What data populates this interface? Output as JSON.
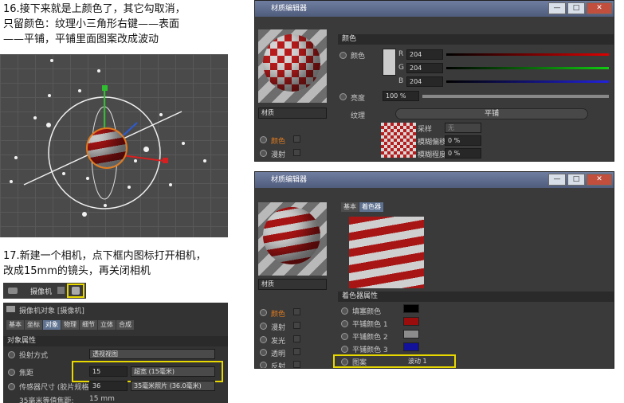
{
  "step16_text": [
    "16.接下来就是上颜色了，其它勾取消，",
    "只留颜色：纹理小三角形右键——表面",
    "——平铺，平铺里面图案改成波动"
  ],
  "step17_text": [
    "17.新建一个相机，点下框内图标打开相机，",
    "改成15mm的镜头，再关闭相机"
  ],
  "win1": {
    "title": "材质编辑器",
    "mat_name": "材质",
    "channels": [
      "颜色",
      "漫射"
    ],
    "section": "颜色",
    "color_label": "颜色",
    "r": "204",
    "g": "204",
    "b": "204",
    "brightness_label": "亮度",
    "brightness": "100 %",
    "texture_label": "纹理",
    "texture_button": "平铺",
    "sample_label": "采样",
    "sample_value": "无",
    "blur_offset_label": "模糊偏移",
    "blur_offset": "0 %",
    "blur_scale_label": "模糊程度",
    "blur_scale": "0 %"
  },
  "win2": {
    "title": "材质编辑器",
    "tabs": [
      "基本",
      "着色器"
    ],
    "mat_name": "材质",
    "channels": [
      "颜色",
      "漫射",
      "发光",
      "透明",
      "反射"
    ],
    "section": "着色器属性",
    "rows": [
      "填塞颜色",
      "平铺颜色 1",
      "平铺颜色 2",
      "平铺颜色 3"
    ],
    "pattern_label": "图案",
    "pattern_value": "波动 1",
    "swatch_colors": [
      "#000000",
      "#9b0d0d",
      "#8c8c8c",
      "#12129a"
    ]
  },
  "camera_bar": {
    "label": "摄像机"
  },
  "camera_panel": {
    "title": "摄像机对象 [摄像机]",
    "tabs": [
      "基本",
      "坐标",
      "对象",
      "物理",
      "细节",
      "立体",
      "合成"
    ],
    "section": "对象属性",
    "projection_label": "投射方式",
    "projection_value": "透视视图",
    "focal_label": "焦距",
    "focal_value": "15",
    "focal_preset": "超宽 (15毫米)",
    "sensor_label": "传感器尺寸 (胶片规格)",
    "sensor_value": "36",
    "sensor_preset": "35毫米照片 (36.0毫米)",
    "fov_label": "35毫米等值焦距:",
    "fov_value": "15 mm"
  },
  "colors": {
    "accent": "#e8d800",
    "title_bar": "#5f6c8e",
    "panel": "#3a3a3a"
  }
}
